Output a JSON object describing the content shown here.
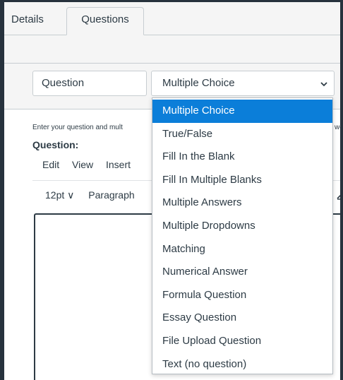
{
  "tabs": [
    {
      "label": "Details",
      "active": false
    },
    {
      "label": "Questions",
      "active": true
    }
  ],
  "question_form": {
    "name_value": "Question",
    "type_value": "Multiple Choice",
    "instructions": "Enter your question and mult",
    "instructions_tail": "we",
    "question_label": "Question:"
  },
  "editor": {
    "menu": [
      "Edit",
      "View",
      "Insert"
    ],
    "font_size": "12pt",
    "block_format": "Paragraph"
  },
  "type_options": [
    "Multiple Choice",
    "True/False",
    "Fill In the Blank",
    "Fill In Multiple Blanks",
    "Multiple Answers",
    "Multiple Dropdowns",
    "Matching",
    "Numerical Answer",
    "Formula Question",
    "Essay Question",
    "File Upload Question",
    "Text (no question)"
  ],
  "selected_option_index": 0,
  "colors": {
    "accent": "#0b7ed9",
    "text": "#2d3b45",
    "border": "#c7cdd1",
    "frame": "#27323d"
  }
}
